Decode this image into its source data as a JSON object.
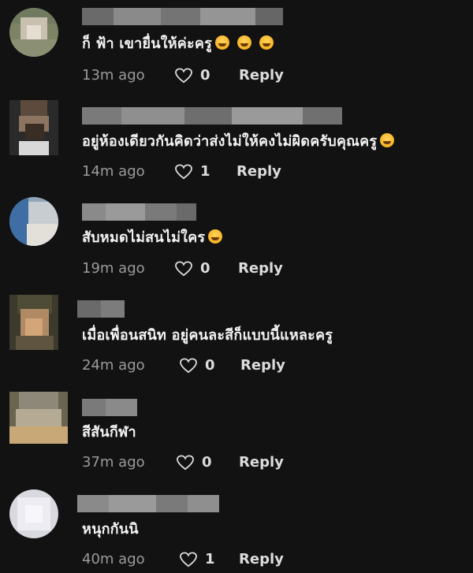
{
  "comments": [
    {
      "text": "ก็ ฟ้า เขายื่นให้ค่ะครู",
      "emoji": [
        "laughing-emoji",
        "laughing-emoji",
        "laughing-emoji"
      ],
      "time": "13m ago",
      "likes": "0",
      "reply_label": "Reply"
    },
    {
      "text": "อยู่ห้องเดียวกันคิดว่าส่งไม่ให้คงไม่ผิดครับคุณครู",
      "emoji": [
        "laughing-emoji"
      ],
      "time": "14m ago",
      "likes": "1",
      "reply_label": "Reply"
    },
    {
      "text": "สับหมดไม่สนไม่ใคร",
      "emoji": [
        "smirk-emoji"
      ],
      "time": "19m ago",
      "likes": "0",
      "reply_label": "Reply"
    },
    {
      "text": "เมื่อเพื่อนสนิท อยู่คนละสีก็แบบนี้แหละครู",
      "emoji": [],
      "time": "24m ago",
      "likes": "0",
      "reply_label": "Reply"
    },
    {
      "text": "สีสันกีฬา",
      "emoji": [],
      "time": "37m ago",
      "likes": "0",
      "reply_label": "Reply"
    },
    {
      "text": "หนุกกันนิ",
      "emoji": [],
      "time": "40m ago",
      "likes": "1",
      "reply_label": "Reply"
    }
  ],
  "colors": {
    "background": "#121212",
    "text": "#f2f2f2",
    "muted": "#9a9a9a"
  }
}
